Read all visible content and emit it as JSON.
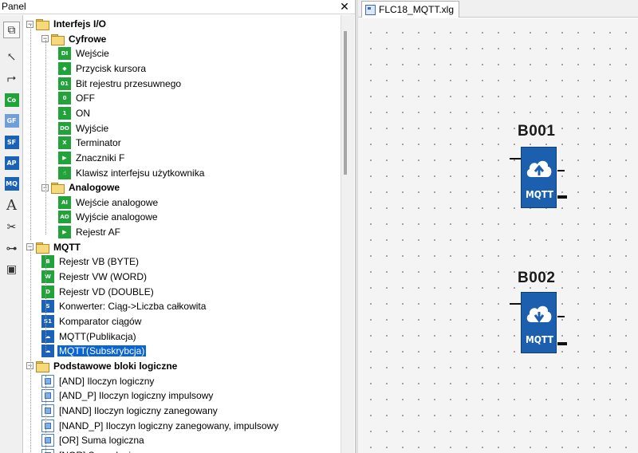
{
  "panel": {
    "title": "Panel",
    "close_glyph": "✕"
  },
  "toolbar": [
    {
      "name": "copy-icon",
      "text": "⧉",
      "type": "glyph"
    },
    {
      "name": "pointer-icon",
      "text": "↖",
      "type": "glyph"
    },
    {
      "name": "connector-icon",
      "text": "⮣",
      "type": "glyph"
    },
    {
      "name": "co-button",
      "text": "Co",
      "color": "#22a33a"
    },
    {
      "name": "gf-button",
      "text": "GF",
      "color": "#6f9fd8"
    },
    {
      "name": "sf-button",
      "text": "SF",
      "color": "#1a62b8"
    },
    {
      "name": "ap-button",
      "text": "AP",
      "color": "#1a62b8"
    },
    {
      "name": "mq-button",
      "text": "MQ",
      "color": "#1a62b8"
    },
    {
      "name": "text-tool-icon",
      "text": "A",
      "type": "glyph"
    },
    {
      "name": "cut-connection-icon",
      "text": "✂",
      "type": "glyph"
    },
    {
      "name": "network-icon",
      "text": "⊶",
      "type": "glyph"
    },
    {
      "name": "device-icon",
      "text": "▣",
      "type": "glyph"
    }
  ],
  "tree": [
    {
      "label": "Interfejs I/O",
      "level": 0,
      "kind": "folder",
      "bold": true
    },
    {
      "label": "Cyfrowe",
      "level": 1,
      "kind": "folder",
      "bold": true
    },
    {
      "label": "Wejście",
      "level": 2,
      "kind": "green",
      "icon": "DI"
    },
    {
      "label": "Przycisk kursora",
      "level": 2,
      "kind": "green",
      "icon": "◆"
    },
    {
      "label": "Bit rejestru przesuwnego",
      "level": 2,
      "kind": "green",
      "icon": "01"
    },
    {
      "label": "OFF",
      "level": 2,
      "kind": "green",
      "icon": "0"
    },
    {
      "label": "ON",
      "level": 2,
      "kind": "green",
      "icon": "1"
    },
    {
      "label": "Wyjście",
      "level": 2,
      "kind": "green",
      "icon": "DO"
    },
    {
      "label": "Terminator",
      "level": 2,
      "kind": "green",
      "icon": "X"
    },
    {
      "label": "Znaczniki F",
      "level": 2,
      "kind": "green",
      "icon": "▶"
    },
    {
      "label": "Klawisz interfejsu użytkownika",
      "level": 2,
      "kind": "green",
      "icon": "☝"
    },
    {
      "label": "Analogowe",
      "level": 1,
      "kind": "folder",
      "bold": true
    },
    {
      "label": "Wejście analogowe",
      "level": 2,
      "kind": "green",
      "icon": "AI"
    },
    {
      "label": "Wyjście analogowe",
      "level": 2,
      "kind": "green",
      "icon": "AO"
    },
    {
      "label": "Rejestr AF",
      "level": 2,
      "kind": "green",
      "icon": "▶"
    },
    {
      "label": "MQTT",
      "level": 0,
      "kind": "folder",
      "bold": true
    },
    {
      "label": "Rejestr VB (BYTE)",
      "level": 1,
      "kind": "green",
      "icon": "B"
    },
    {
      "label": "Rejestr VW (WORD)",
      "level": 1,
      "kind": "green",
      "icon": "W"
    },
    {
      "label": "Rejestr VD (DOUBLE)",
      "level": 1,
      "kind": "green",
      "icon": "D"
    },
    {
      "label": "Konwerter: Ciąg->Liczba całkowita",
      "level": 1,
      "kind": "blue",
      "icon": "S"
    },
    {
      "label": "Komparator ciągów",
      "level": 1,
      "kind": "blue",
      "icon": "S1"
    },
    {
      "label": "MQTT(Publikacja)",
      "level": 1,
      "kind": "blue",
      "icon": "☁"
    },
    {
      "label": "MQTT(Subskrybcja)",
      "level": 1,
      "kind": "blue",
      "icon": "☁",
      "selected": true
    },
    {
      "label": "Podstawowe bloki logiczne",
      "level": 0,
      "kind": "folder",
      "bold": true
    },
    {
      "label": "[AND] Iloczyn logiczny",
      "level": 1,
      "kind": "lblue"
    },
    {
      "label": "[AND_P] Iloczyn logiczny impulsowy",
      "level": 1,
      "kind": "lblue"
    },
    {
      "label": "[NAND] Iloczyn logiczny zanegowany",
      "level": 1,
      "kind": "lblue"
    },
    {
      "label": "[NAND_P] Iloczyn logiczny zanegowany, impulsowy",
      "level": 1,
      "kind": "lblue"
    },
    {
      "label": "[OR] Suma logiczna",
      "level": 1,
      "kind": "lblue"
    },
    {
      "label": "[NOR] Suma logiczna zanegowana",
      "level": 1,
      "kind": "lblue"
    }
  ],
  "document": {
    "tab_label": "FLC18_MQTT.xlg"
  },
  "blocks": [
    {
      "id": "B001",
      "label": "MQTT",
      "arrow": "up"
    },
    {
      "id": "B002",
      "label": "MQTT",
      "arrow": "down"
    }
  ]
}
